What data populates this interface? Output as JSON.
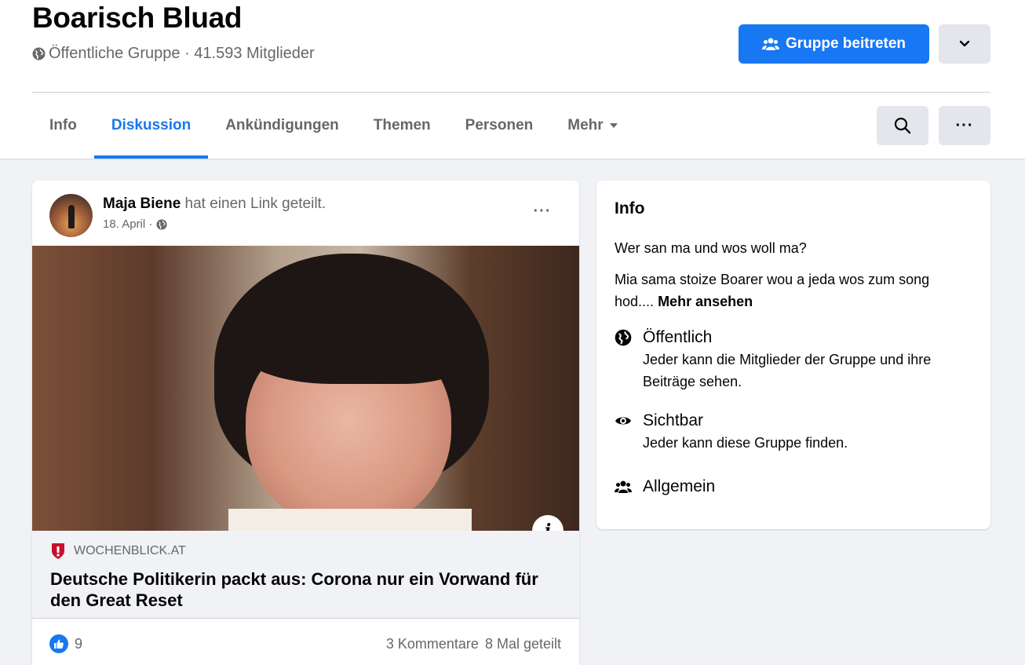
{
  "group": {
    "name": "Boarisch Bluad",
    "meta": "Öffentliche Gruppe · 41.593 Mitglieder",
    "join_label": "Gruppe beitreten"
  },
  "tabs": [
    {
      "label": "Info"
    },
    {
      "label": "Diskussion",
      "active": true
    },
    {
      "label": "Ankündigungen"
    },
    {
      "label": "Themen"
    },
    {
      "label": "Personen"
    },
    {
      "label": "Mehr"
    }
  ],
  "more_dots": "···",
  "post": {
    "author": "Maja Biene",
    "action": " hat einen Link geteilt.",
    "date": "18. April ·",
    "menu_dots": "···",
    "image_info_glyph": "i",
    "link": {
      "source": "WOCHENBLICK.AT",
      "title": "Deutsche Politikerin packt aus: Corona nur ein Vorwand für den Great Reset"
    },
    "likes": "9",
    "comments": "3 Kommentare",
    "shares": "8 Mal geteilt"
  },
  "info": {
    "title": "Info",
    "question": "Wer san ma und wos woll ma?",
    "description": "Mia sama stoize Boarer wou a jeda wos zum song hod....",
    "see_more": "Mehr ansehen",
    "items": [
      {
        "icon": "globe-icon",
        "head": "Öffentlich",
        "sub": "Jeder kann die Mitglieder der Gruppe und ihre Beiträge sehen."
      },
      {
        "icon": "eye-icon",
        "head": "Sichtbar",
        "sub": "Jeder kann diese Gruppe finden."
      },
      {
        "icon": "people-icon",
        "head": "Allgemein",
        "sub": ""
      }
    ]
  },
  "colors": {
    "accent": "#1877f2",
    "background": "#f0f2f5",
    "secondary_text": "#65676b",
    "source_red": "#c8102e"
  }
}
